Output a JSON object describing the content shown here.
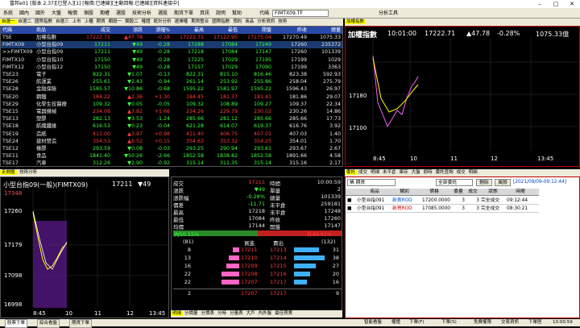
{
  "window": {
    "title": "富邦e01 [版本 2.37][已登入][1] [報價:已連線][主動回報:已連線][資料連接中]"
  },
  "toolbar": {
    "items": [
      "系統",
      "國內",
      "國外",
      "大盤",
      "報價",
      "個股",
      "期權",
      "選股",
      "技術分析",
      "選股",
      "期貨下單",
      "資訊",
      "說明",
      "幫助"
    ],
    "code_label": "代碼",
    "code_value": "FIMTX09.TF",
    "analysis_label": "分析工具"
  },
  "quote_tabs": [
    "自選一",
    "自選二",
    "國際指數",
    "自選三",
    "上市",
    "上櫃",
    "期貨",
    "類股一",
    "類股二",
    "權證",
    "統計分析",
    "選擇權",
    "期貨整合",
    "國際指數",
    "預約",
    "商品",
    "分析資訊",
    "技術"
  ],
  "quote_header": [
    "代碼",
    "商品",
    "成交",
    "漲跌",
    "漲幅%",
    "最高",
    "最低",
    "開盤",
    "昨收",
    "總量"
  ],
  "quote_rows": [
    {
      "code": "TSE",
      "name": "加權指數",
      "price": "17222.71",
      "chg": "▲47.78",
      "pct": "-0.28",
      "high": "17222.71",
      "low": "17122.95",
      "open": "17175.04",
      "prev": "17270.49",
      "vol": "1075.33",
      "dir": "up"
    },
    {
      "code": "FIMTX09",
      "name": "小型台指09",
      "price": "17211",
      "chg": "▼49",
      "pct": "-0.28",
      "high": "17288",
      "low": "17084",
      "open": "17249",
      "prev": "17260",
      "vol": "235372",
      "dir": "dn"
    },
    {
      "code": ">>FIMTX09",
      "name": "小型台指09",
      "price": "17211",
      "chg": "▼49",
      "pct": "-0.28",
      "high": "17218",
      "low": "17084",
      "open": "17147",
      "prev": "17260",
      "vol": "101339",
      "dir": "dn"
    },
    {
      "code": "FIMTX10",
      "name": "小型台指10",
      "price": "17150",
      "chg": "▼49",
      "pct": "-0.28",
      "high": "17225",
      "low": "17029",
      "open": "17195",
      "prev": "17199",
      "vol": "1029",
      "dir": "dn"
    },
    {
      "code": "FIMTX12",
      "name": "小型台指12",
      "price": "17150",
      "chg": "▼49",
      "pct": "-0.28",
      "high": "17157",
      "low": "17029",
      "open": "17090",
      "prev": "17199",
      "vol": "3363",
      "dir": "dn"
    },
    {
      "code": "TSE23",
      "name": "電子",
      "price": "822.31",
      "chg": "▼1.07",
      "pct": "-0.13",
      "high": "822.31",
      "low": "815.10",
      "open": "816.46",
      "prev": "823.38",
      "vol": "592.93",
      "dir": "dn"
    },
    {
      "code": "TSE26",
      "name": "航運業",
      "price": "255.61",
      "chg": "▼2.43",
      "pct": "-0.94",
      "high": "261.14",
      "open": "255.86",
      "low": "253.92",
      "prev": "258.04",
      "vol": "275.79",
      "dir": "dn"
    },
    {
      "code": "TSE28",
      "name": "金融保險",
      "price": "1585.57",
      "chg": "▼10.86",
      "pct": "-0.68",
      "high": "1595.22",
      "low": "1581.97",
      "open": "1595.22",
      "prev": "1596.43",
      "vol": "26.97",
      "dir": "dn"
    },
    {
      "code": "TSE20",
      "name": "鋼鐵",
      "price": "184.22",
      "chg": "▲2.36",
      "pct": "+1.30",
      "high": "184.45",
      "low": "181.37",
      "open": "181.41",
      "prev": "181.86",
      "vol": "29.07",
      "dir": "up"
    },
    {
      "code": "TSE29",
      "name": "化學生技醫療",
      "price": "109.32",
      "chg": "▼0.05",
      "pct": "-0.05",
      "high": "109.32",
      "low": "108.89",
      "open": "109.27",
      "prev": "109.37",
      "vol": "22.34",
      "dir": "dn"
    },
    {
      "code": "TSE15",
      "name": "電器機械",
      "price": "234.08",
      "chg": "▲3.82",
      "pct": "+1.66",
      "high": "234.26",
      "low": "229.79",
      "open": "230.02",
      "prev": "230.26",
      "vol": "14.86",
      "dir": "up"
    },
    {
      "code": "TSE13",
      "name": "塑膠",
      "price": "282.13",
      "chg": "▼3.53",
      "pct": "-1.24",
      "high": "285.66",
      "low": "281.12",
      "open": "285.66",
      "prev": "285.66",
      "vol": "17.73",
      "dir": "dn"
    },
    {
      "code": "TSE18",
      "name": "紡織纖維",
      "price": "616.53",
      "chg": "▼0.23",
      "pct": "-0.04",
      "high": "621.28",
      "low": "614.07",
      "open": "619.37",
      "prev": "616.76",
      "vol": "3.92",
      "dir": "dn"
    },
    {
      "code": "TSE19",
      "name": "造紙",
      "price": "411.00",
      "chg": "▲3.97",
      "pct": "+0.98",
      "high": "411.40",
      "low": "406.75",
      "open": "407.01",
      "prev": "407.03",
      "vol": "1.40",
      "dir": "up"
    },
    {
      "code": "TSE24",
      "name": "建材營造",
      "price": "354.53",
      "chg": "▲6.52",
      "pct": "+0.15",
      "high": "354.63",
      "low": "353.32",
      "open": "354.25",
      "prev": "354.01",
      "vol": "1.70",
      "dir": "up"
    },
    {
      "code": "TSE12",
      "name": "橡膠",
      "price": "293.59",
      "chg": "▼0.08",
      "pct": "-0.03",
      "high": "293.25",
      "low": "290.94",
      "open": "293.61",
      "prev": "293.67",
      "vol": "2.67",
      "dir": "dn"
    },
    {
      "code": "TSE11",
      "name": "食品",
      "price": "1841.40",
      "chg": "▼50.26",
      "pct": "-2.66",
      "high": "1852.58",
      "low": "1838.82",
      "open": "1852.58",
      "prev": "1891.66",
      "vol": "4.58",
      "dir": "dn"
    },
    {
      "code": "TSE17",
      "name": "汽車",
      "price": "312.26",
      "chg": "▼2.90",
      "pct": "-0.92",
      "high": "315.14",
      "low": "311.35",
      "open": "315.14",
      "prev": "315.16",
      "vol": "2.17",
      "dir": "dn"
    }
  ],
  "index_chart": {
    "tab_label": "加權指數",
    "title": "加權指數",
    "time": "10:01:00",
    "price": "17222.71",
    "chg": "▲47.78",
    "pct": "-0.28%",
    "vol": "1075.33億",
    "y_ticks": [
      "17180",
      "17100"
    ],
    "x_ticks": [
      "8:45",
      "10",
      "11",
      "12",
      "13:45"
    ]
  },
  "futures_tabs": [
    "走勢圖",
    "技術分析"
  ],
  "futures_chart": {
    "title": "小型台指09(一般)(FIMTX09)",
    "price": "17211",
    "chg": "▼49",
    "y_ticks": [
      "17348",
      "17260",
      "17179",
      "17098",
      "16998"
    ],
    "x_ticks": [
      "8:45",
      "10",
      "11",
      "12",
      "13:45"
    ]
  },
  "detail": {
    "rows": [
      {
        "l": "成交",
        "v": "17211",
        "l2": "時間",
        "v2": "10:00:59"
      },
      {
        "l": "漲跌",
        "v": "▼49",
        "l2": "單量",
        "v2": "2"
      },
      {
        "l": "漲跌幅",
        "v": "-0.28%",
        "l2": "總量",
        "v2": "101339"
      },
      {
        "l": "價差",
        "v": "-11.71",
        "l2": "未平倉",
        "v2": "259181"
      },
      {
        "l": "最高",
        "v": "17218",
        "l2": "未平倉",
        "v2": "17248"
      },
      {
        "l": "最低",
        "v": "17084",
        "l2": "昨收",
        "v2": "17260"
      },
      {
        "l": "均價",
        "v": "17144",
        "l2": "開盤",
        "v2": "17147"
      }
    ],
    "ratio_left": "內50.15%",
    "ratio_right": "外49.85%",
    "bid_total": "(81)",
    "ask_total": "(132)",
    "bid_label": "買進",
    "ask_label": "賣出",
    "book": [
      {
        "bq": "8",
        "bp": "17211",
        "ap": "17213",
        "aq": "31"
      },
      {
        "bq": "13",
        "bp": "17210",
        "ap": "17214",
        "aq": "38"
      },
      {
        "bq": "16",
        "bp": "17209",
        "ap": "17215",
        "aq": "27"
      },
      {
        "bq": "22",
        "bp": "17208",
        "ap": "17216",
        "aq": "20"
      },
      {
        "bq": "22",
        "bp": "17207",
        "ap": "17217",
        "aq": "16"
      }
    ],
    "last": {
      "bq": "2",
      "bp": "17207",
      "ap": "17217",
      "aq": "9"
    }
  },
  "detail_tabs": [
    "明細",
    "分價量",
    "分價表",
    "分時",
    "分量表",
    "大戶",
    "內外盤",
    "最佳買賣"
  ],
  "orders": {
    "tabs": [
      "委託",
      "成交",
      "明細",
      "未平倉",
      "庫存",
      "大盤",
      "即時",
      "委託查詢",
      "成交",
      "明細"
    ],
    "account_placeholder": "帳 期貨",
    "filter_value": "全部委託",
    "delete_label": "刪除",
    "refresh_label": "風險",
    "date_label": "[2021/09/09-09:12:44]",
    "header": [
      "",
      "商品",
      "類別",
      "價格",
      "委量",
      "成交",
      "狀態",
      "時間"
    ],
    "rows": [
      {
        "sel": "■",
        "name": "小型台指091",
        "type": "新賣ROD",
        "price": "17200.0000",
        "qty": "3",
        "fill": "3",
        "status": "完全成交",
        "time": "09:12:44"
      },
      {
        "sel": "■",
        "name": "小型台指091",
        "type": "新買ROD",
        "price": "17085.0000",
        "qty": "3",
        "fill": "3",
        "status": "完全成交",
        "time": "08:30:21"
      }
    ]
  },
  "status": {
    "left_items": [
      "股票下單",
      "綜合看盤",
      "期貨下單"
    ],
    "right_items": [
      "智能看盤",
      "權證",
      "下單(F)",
      "下單(S)",
      "免費權限",
      "交易資訊",
      "下單匣"
    ],
    "clock": "10:00:59"
  },
  "colors": {
    "up": "#ff3b3b",
    "down": "#3bff3b",
    "header": "#2a4aa8",
    "panel_border": "#c00000"
  }
}
